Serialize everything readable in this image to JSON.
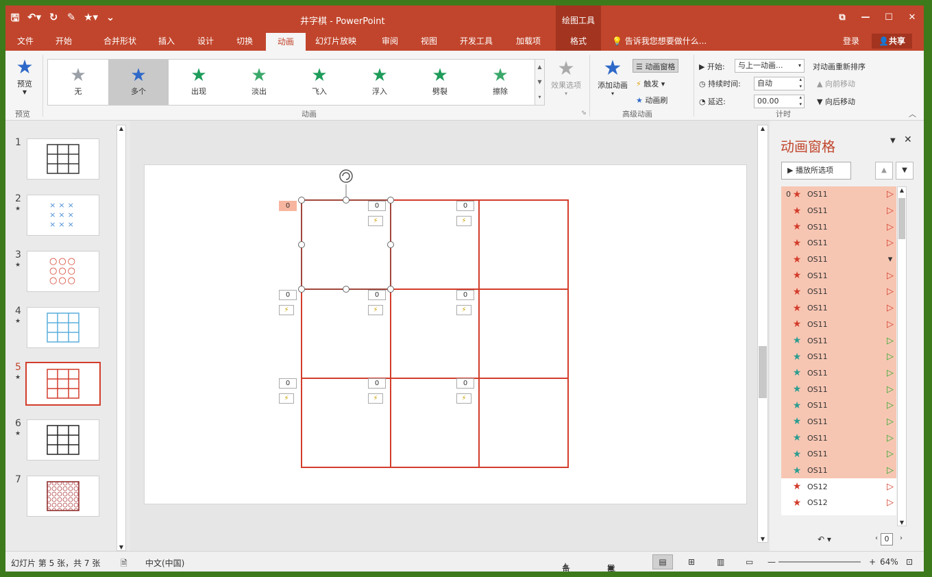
{
  "window": {
    "title": "井字棋 - PowerPoint",
    "context_group": "绘图工具",
    "controls": {
      "restore": "⧉",
      "minimize": "—",
      "maximize": "☐",
      "close": "✕"
    }
  },
  "qat": {
    "save": "🖫",
    "undo": "↶▾",
    "redo": "↻",
    "format": "✎",
    "star": "★▾",
    "more": "⌄"
  },
  "tabs": [
    "文件",
    "开始",
    "合并形状",
    "插入",
    "设计",
    "切换",
    "动画",
    "幻灯片放映",
    "审阅",
    "视图",
    "开发工具",
    "加载项",
    "格式"
  ],
  "active_tab": "动画",
  "tell_me": "告诉我您想要做什么...",
  "account": {
    "login": "登录",
    "share": "共享"
  },
  "ribbon": {
    "preview": {
      "label": "预览",
      "group": "预览"
    },
    "animations_group": "动画",
    "gallery": [
      {
        "label": "无",
        "color": "#9aa0a6"
      },
      {
        "label": "多个",
        "color": "#2e69c9"
      },
      {
        "label": "出现",
        "color": "#1e9c5a"
      },
      {
        "label": "淡出",
        "color": "#3aa86a"
      },
      {
        "label": "飞入",
        "color": "#1e9c5a"
      },
      {
        "label": "浮入",
        "color": "#1e9c5a"
      },
      {
        "label": "劈裂",
        "color": "#1e9c5a"
      },
      {
        "label": "擦除",
        "color": "#3aa86a"
      }
    ],
    "effect_options": "效果选项",
    "adv_group": "高级动画",
    "add_animation": "添加动画",
    "anim_pane": "动画窗格",
    "trigger": "触发",
    "painter": "动画刷",
    "timing_group": "计时",
    "start_label": "开始:",
    "start_value": "与上一动画...",
    "duration_label": "持续时间:",
    "duration_value": "自动",
    "delay_label": "延迟:",
    "delay_value": "00.00",
    "reorder": "对动画重新排序",
    "move_earlier": "向前移动",
    "move_later": "向后移动"
  },
  "thumbnails": [
    {
      "num": "1"
    },
    {
      "num": "2"
    },
    {
      "num": "3"
    },
    {
      "num": "4"
    },
    {
      "num": "5"
    },
    {
      "num": "6"
    },
    {
      "num": "7"
    }
  ],
  "slide_tags": {
    "zero": "0",
    "bolt": "⚡"
  },
  "anim_pane": {
    "title": "动画窗格",
    "play_button": "播放所选项",
    "items": [
      {
        "num": "0",
        "name": "OS11",
        "star": "#d23c2a",
        "marker": "▷",
        "mcolor": "#d23c2a",
        "hl": true
      },
      {
        "num": "",
        "name": "OS11",
        "star": "#d23c2a",
        "marker": "▷",
        "mcolor": "#d23c2a",
        "hl": true
      },
      {
        "num": "",
        "name": "OS11",
        "star": "#d23c2a",
        "marker": "▷",
        "mcolor": "#d23c2a",
        "hl": true
      },
      {
        "num": "",
        "name": "OS11",
        "star": "#d23c2a",
        "marker": "▷",
        "mcolor": "#d23c2a",
        "hl": true
      },
      {
        "num": "",
        "name": "OS11",
        "star": "#d23c2a",
        "marker": "▾",
        "mcolor": "#333333",
        "hl": true
      },
      {
        "num": "",
        "name": "OS11",
        "star": "#d23c2a",
        "marker": "▷",
        "mcolor": "#d23c2a",
        "hl": true
      },
      {
        "num": "",
        "name": "OS11",
        "star": "#d23c2a",
        "marker": "▷",
        "mcolor": "#d23c2a",
        "hl": true
      },
      {
        "num": "",
        "name": "OS11",
        "star": "#d23c2a",
        "marker": "▷",
        "mcolor": "#d23c2a",
        "hl": true
      },
      {
        "num": "",
        "name": "OS11",
        "star": "#d23c2a",
        "marker": "▷",
        "mcolor": "#d23c2a",
        "hl": true
      },
      {
        "num": "",
        "name": "OS11",
        "star": "#2a9d8f",
        "marker": "▷",
        "mcolor": "#2eaa2e",
        "hl": true
      },
      {
        "num": "",
        "name": "OS11",
        "star": "#2a9d8f",
        "marker": "▷",
        "mcolor": "#2eaa2e",
        "hl": true
      },
      {
        "num": "",
        "name": "OS11",
        "star": "#2a9d8f",
        "marker": "▷",
        "mcolor": "#2eaa2e",
        "hl": true
      },
      {
        "num": "",
        "name": "OS11",
        "star": "#2a9d8f",
        "marker": "▷",
        "mcolor": "#2eaa2e",
        "hl": true
      },
      {
        "num": "",
        "name": "OS11",
        "star": "#2a9d8f",
        "marker": "▷",
        "mcolor": "#2eaa2e",
        "hl": true
      },
      {
        "num": "",
        "name": "OS11",
        "star": "#2a9d8f",
        "marker": "▷",
        "mcolor": "#2eaa2e",
        "hl": true
      },
      {
        "num": "",
        "name": "OS11",
        "star": "#2a9d8f",
        "marker": "▷",
        "mcolor": "#2eaa2e",
        "hl": true
      },
      {
        "num": "",
        "name": "OS11",
        "star": "#2a9d8f",
        "marker": "▷",
        "mcolor": "#2eaa2e",
        "hl": true
      },
      {
        "num": "",
        "name": "OS11",
        "star": "#2a9d8f",
        "marker": "▷",
        "mcolor": "#2eaa2e",
        "hl": true
      },
      {
        "num": "",
        "name": "OS12",
        "star": "#d23c2a",
        "marker": "▷",
        "mcolor": "#d23c2a",
        "hl": false
      },
      {
        "num": "",
        "name": "OS12",
        "star": "#d23c2a",
        "marker": "▷",
        "mcolor": "#d23c2a",
        "hl": false
      },
      {
        "num": "",
        "name": "OS12",
        "star": "#d23c2a",
        "marker": "▷",
        "mcolor": "#d23c2a",
        "hl": false
      }
    ],
    "page_num": "0"
  },
  "status": {
    "slide": "幻灯片 第 5 张，共 7 张",
    "lang": "中文(中国)",
    "notes": "备注",
    "comments": "批注",
    "zoom": "64%"
  }
}
